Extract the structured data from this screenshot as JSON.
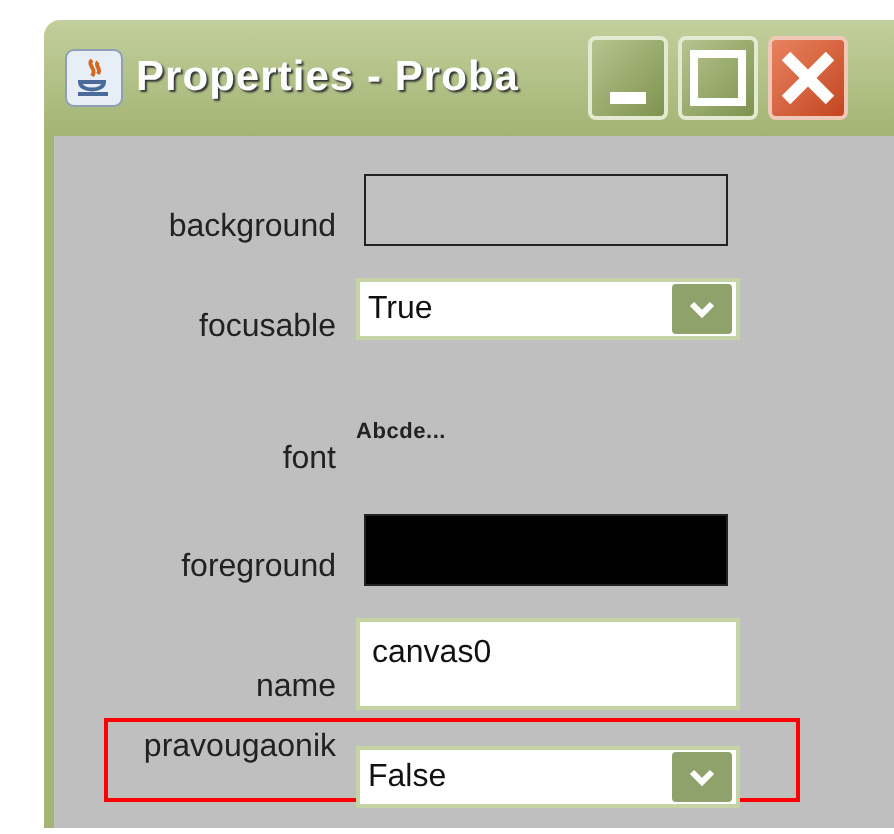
{
  "window": {
    "title": "Properties - Proba"
  },
  "properties": [
    {
      "kind": "color",
      "label": "background",
      "color": "#c0c0c0",
      "highlighted": false
    },
    {
      "kind": "combo",
      "label": "focusable",
      "value": "True",
      "highlighted": false
    },
    {
      "kind": "font",
      "label": "font",
      "value": "Abcde...",
      "highlighted": false
    },
    {
      "kind": "color",
      "label": "foreground",
      "color": "#000000",
      "highlighted": false
    },
    {
      "kind": "text",
      "label": "name",
      "value": "canvas0",
      "highlighted": false
    },
    {
      "kind": "combo",
      "label": "pravougaonik",
      "value": "False",
      "highlighted": true
    }
  ]
}
